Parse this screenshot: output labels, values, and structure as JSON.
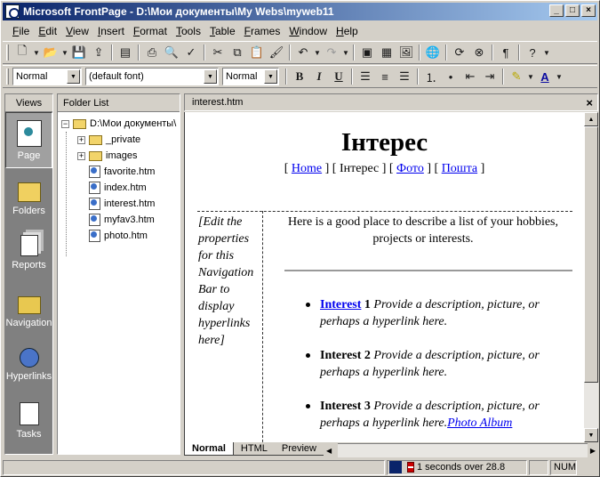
{
  "window": {
    "title": "Microsoft FrontPage - D:\\Мои документы\\My Webs\\myweb11",
    "minimize": "_",
    "maximize": "□",
    "close": "×"
  },
  "menu": {
    "items": [
      {
        "ul": "F",
        "rest": "ile"
      },
      {
        "ul": "E",
        "rest": "dit"
      },
      {
        "ul": "V",
        "rest": "iew"
      },
      {
        "ul": "I",
        "rest": "nsert"
      },
      {
        "ul": "F",
        "rest": "ormat",
        "ulpos": "first"
      },
      {
        "ul": "T",
        "rest": "ools"
      },
      {
        "ul": "T",
        "rest": "able"
      },
      {
        "ul": "F",
        "rest": "rames"
      },
      {
        "ul": "W",
        "rest": "indow"
      },
      {
        "ul": "H",
        "rest": "elp"
      }
    ]
  },
  "format_toolbar": {
    "style": "Normal",
    "font": "(default font)",
    "size": "Normal",
    "bold": "B",
    "italic": "I",
    "underline": "U"
  },
  "views": {
    "header": "Views",
    "items": [
      {
        "label": "Page",
        "icon": "page-view-icon"
      },
      {
        "label": "Folders",
        "icon": "folders-view-icon"
      },
      {
        "label": "Reports",
        "icon": "reports-view-icon"
      },
      {
        "label": "Navigation",
        "icon": "navigation-view-icon"
      },
      {
        "label": "Hyperlinks",
        "icon": "hyperlinks-view-icon"
      },
      {
        "label": "Tasks",
        "icon": "tasks-view-icon"
      }
    ]
  },
  "folder_list": {
    "header": "Folder List",
    "root": "D:\\Мои документы\\",
    "folders": [
      "_private",
      "images"
    ],
    "files": [
      "favorite.htm",
      "index.htm",
      "interest.htm",
      "myfav3.htm",
      "photo.htm"
    ]
  },
  "editor": {
    "tab_title": "interest.htm",
    "close": "×",
    "page": {
      "heading": "Інтерес",
      "nav": {
        "home": "Home",
        "current": "Інтерес",
        "photo": "Фото",
        "mail": "Пошта"
      },
      "nav_placeholder": "[Edit the properties for this Navigation Bar to display hyperlinks here]",
      "intro": "Here is a good place to describe a list of your hobbies, projects or interests.",
      "items": [
        {
          "title_link": "Interest",
          "title_num": "1",
          "desc": "Provide a description, picture, or perhaps a hyperlink here."
        },
        {
          "title": "Interest 2",
          "desc": "Provide a description, picture, or perhaps a hyperlink here."
        },
        {
          "title": "Interest 3",
          "desc": "Provide a description, picture, or perhaps a hyperlink here.",
          "extra_link": "Photo Album"
        }
      ]
    },
    "tabs": [
      "Normal",
      "HTML",
      "Preview"
    ]
  },
  "status": {
    "timing": "1 seconds over 28.8",
    "num": "NUM"
  }
}
